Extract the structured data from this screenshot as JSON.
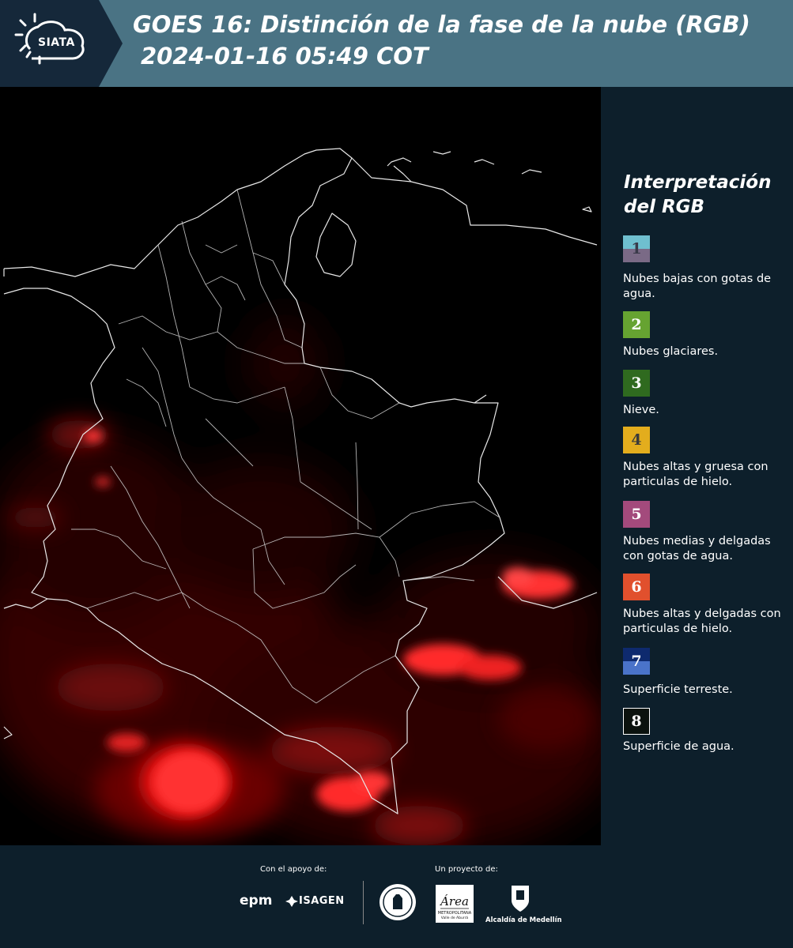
{
  "header": {
    "title_line1": "GOES 16: Distinción de la fase de la nube (RGB)",
    "title_line2": "2024-01-16 05:49 COT",
    "logo_text": "SIATA"
  },
  "legend": {
    "title_line1": "Interpretación",
    "title_line2": "del RGB",
    "items": [
      {
        "number": "1",
        "label": "Nubes bajas con gotas de agua.",
        "color_top": "#6fbfcf",
        "color_bottom": "#7a6a86"
      },
      {
        "number": "2",
        "label": "Nubes glaciares.",
        "color": "#66a331"
      },
      {
        "number": "3",
        "label": "Nieve.",
        "color": "#2f6a1f"
      },
      {
        "number": "4",
        "label": "Nubes altas y gruesa con particulas de hielo.",
        "color": "#e3ad1d"
      },
      {
        "number": "5",
        "label": "Nubes medias y delgadas con gotas de agua.",
        "color": "#a34a7c"
      },
      {
        "number": "6",
        "label": "Nubes altas y delgadas con particulas de hielo.",
        "color": "#e1502d"
      },
      {
        "number": "7",
        "label": "Superficie terreste.",
        "color_top": "#0e2a6e",
        "color_bottom": "#4a73c9"
      },
      {
        "number": "8",
        "label": "Superficie de agua.",
        "color": "#0b120e"
      }
    ]
  },
  "footer": {
    "support_label": "Con el apoyo de:",
    "project_label": "Un proyecto de:",
    "sponsor_epm": "epm",
    "sponsor_isagen": "ISAGEN",
    "area_label": "Área METROPOLITANA Valle de Aburrá",
    "alcaldia_label": "Alcaldía de Medellín"
  }
}
